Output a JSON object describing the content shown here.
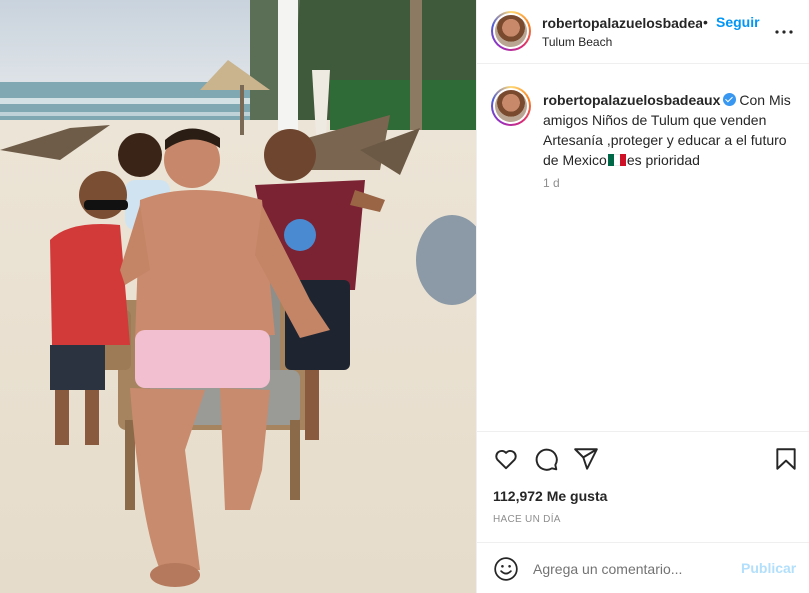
{
  "post": {
    "username": "robertopalazuelosbadeaux",
    "username_header": "robertopalazuelosbadea",
    "separator": "•",
    "follow_label": "Seguir",
    "location": "Tulum Beach",
    "caption_part1": "Con Mis amigos Niños de Tulum que venden Artesanía ,proteger y educar a el futuro de Mexico",
    "caption_part2": "es prioridad",
    "caption_time": "1 d",
    "likes": "112,972 Me gusta",
    "date": "HACE UN DÍA"
  },
  "comment": {
    "placeholder": "Agrega un comentario...",
    "publish_label": "Publicar"
  },
  "icons": {
    "more": "more-options-icon",
    "like": "heart-icon",
    "comment": "comment-icon",
    "share": "paper-plane-icon",
    "save": "bookmark-icon",
    "emoji": "emoji-icon",
    "verified": "verified-badge-icon",
    "flag": "mexico-flag-icon"
  },
  "colors": {
    "follow": "#0095f6",
    "publish_disabled": "#b2dffc",
    "muted": "#8e8e8e",
    "verified": "#3897f0"
  }
}
